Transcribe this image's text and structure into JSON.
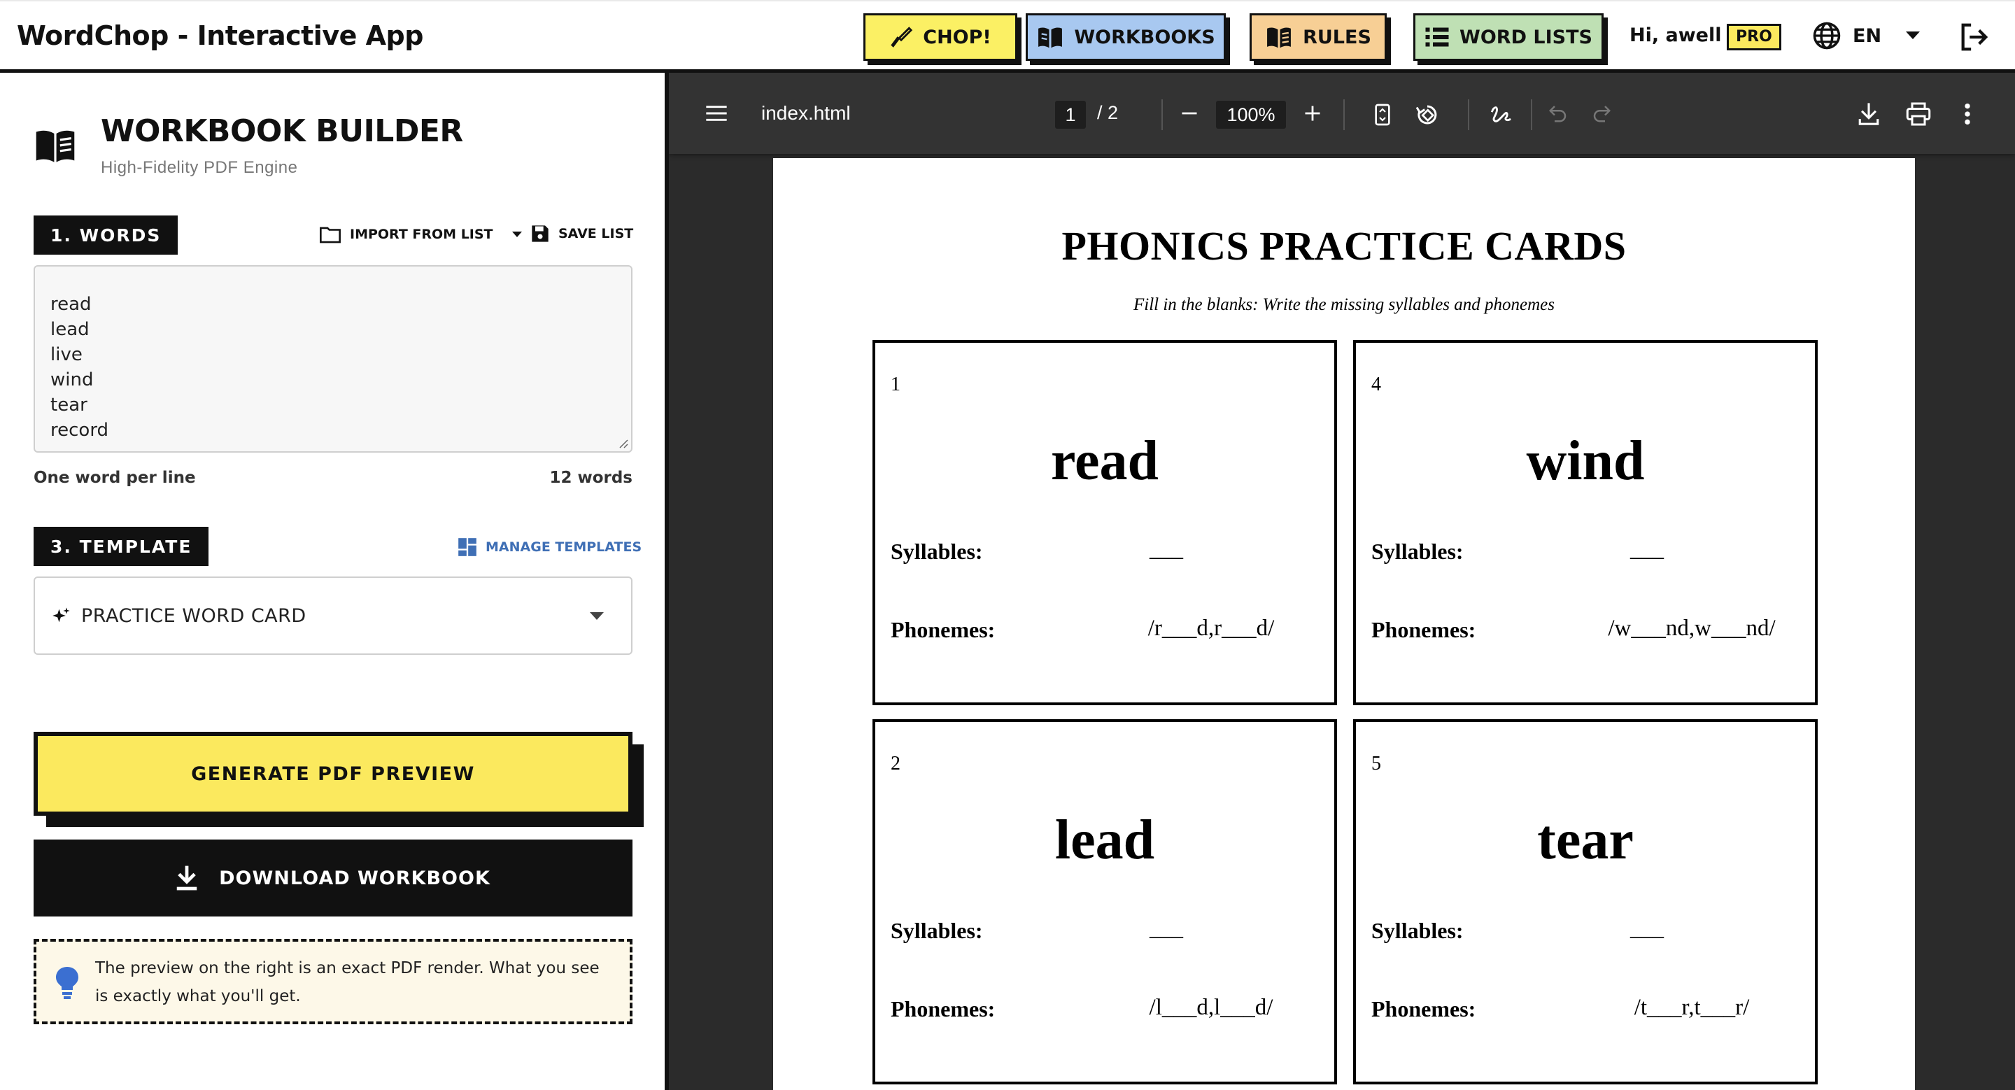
{
  "header": {
    "app_title": "WordChop - Interactive App",
    "nav": {
      "chop": "CHOP!",
      "workbooks": "WORKBOOKS",
      "rules": "RULES",
      "word_lists": "WORD LISTS"
    },
    "greeting": "Hi, awell",
    "badge": "PRO",
    "language": "EN"
  },
  "builder": {
    "title": "WORKBOOK BUILDER",
    "subtitle": "High-Fidelity PDF Engine",
    "words_section": {
      "label": "1. WORDS",
      "import_label": "IMPORT FROM LIST",
      "save_label": "SAVE LIST",
      "words": [
        "read",
        "lead",
        "live",
        "wind",
        "tear",
        "record"
      ],
      "hint": "One word per line",
      "count": "12 words"
    },
    "template_section": {
      "label": "3. TEMPLATE",
      "manage_label": "MANAGE TEMPLATES",
      "selected": "PRACTICE WORD CARD"
    },
    "generate_label": "GENERATE PDF PREVIEW",
    "download_label": "DOWNLOAD WORKBOOK",
    "info_text": "The preview on the right is an exact PDF render. What you see is exactly what you'll get."
  },
  "viewer": {
    "filename": "index.html",
    "current_page": "1",
    "page_total": "/ 2",
    "zoom": "100%",
    "page": {
      "title": "PHONICS PRACTICE CARDS",
      "subtitle": "Fill in the blanks: Write the missing syllables and phonemes",
      "syllables_label": "Syllables:",
      "phonemes_label": "Phonemes:",
      "cards": [
        {
          "number": "1",
          "word": "read",
          "syllables": "___",
          "phonemes": "/r___d,r___d/"
        },
        {
          "number": "4",
          "word": "wind",
          "syllables": "___",
          "phonemes": "/w___nd,w___nd/"
        },
        {
          "number": "2",
          "word": "lead",
          "syllables": "___",
          "phonemes": "/l___d,l___d/"
        },
        {
          "number": "5",
          "word": "tear",
          "syllables": "___",
          "phonemes": "/t___r,t___r/"
        }
      ]
    }
  },
  "colors": {
    "chop": "#fbf064",
    "workbooks": "#a8c8f0",
    "rules": "#f7cf95",
    "word_lists": "#bfe0b4",
    "accent_yellow": "#fbe95e",
    "link_blue": "#3f6fb5",
    "bulb_blue": "#3b6fd1",
    "viewer_bg": "#2b2b2b"
  }
}
